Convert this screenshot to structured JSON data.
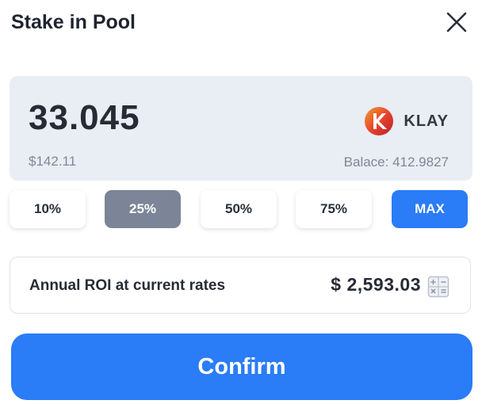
{
  "dialog": {
    "title": "Stake in Pool",
    "close_icon": "close-icon"
  },
  "amount": {
    "value": "33.045",
    "usd": "$142.11",
    "token_name": "KLAY",
    "token_icon": "klay-token-icon",
    "balance": "Balace: 412.9827"
  },
  "percent_buttons": [
    {
      "label": "10%",
      "selected": false
    },
    {
      "label": "25%",
      "selected": true
    },
    {
      "label": "50%",
      "selected": false
    },
    {
      "label": "75%",
      "selected": false
    },
    {
      "label": "MAX",
      "selected": false
    }
  ],
  "roi": {
    "label": "Annual ROI at current rates",
    "value": "$ 2,593.03",
    "icon": "calculator-icon"
  },
  "confirm_label": "Confirm",
  "colors": {
    "accent": "#2a7cf7",
    "selected": "#7b8597",
    "card_bg": "#e9edf4"
  }
}
